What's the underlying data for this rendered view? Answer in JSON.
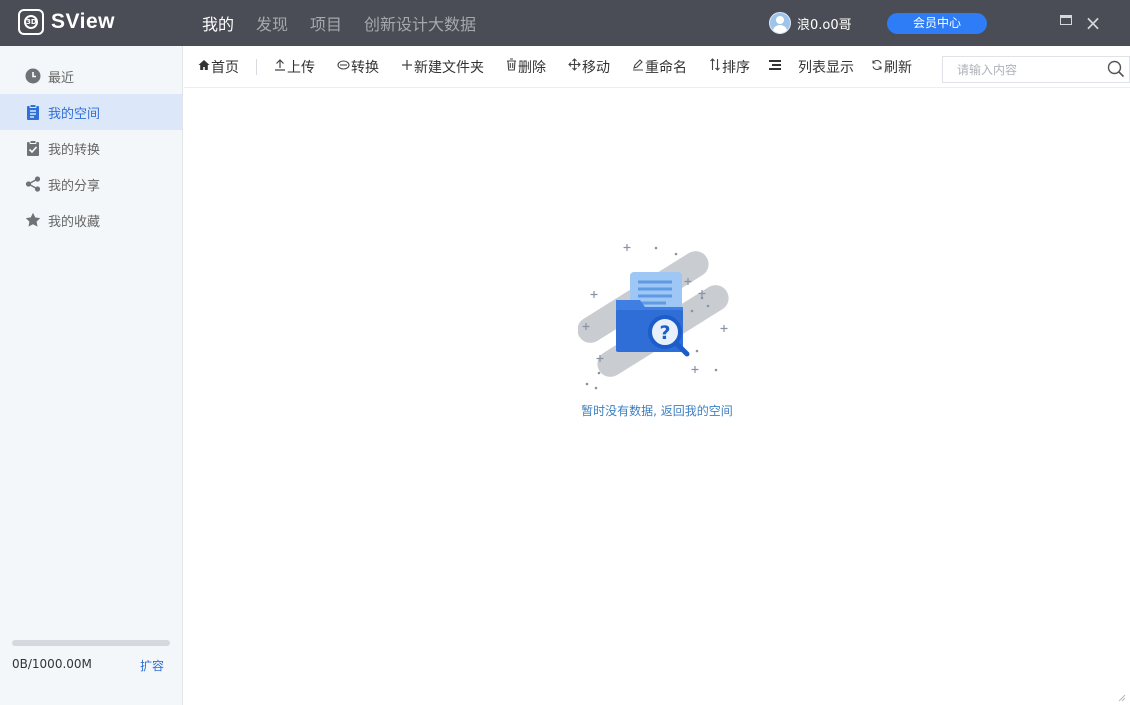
{
  "app": {
    "name": "SView",
    "logo_mark": "3D"
  },
  "nav": [
    {
      "label": "我的",
      "active": true
    },
    {
      "label": "发现",
      "active": false
    },
    {
      "label": "项目",
      "active": false
    },
    {
      "label": "创新设计大数据",
      "active": false
    }
  ],
  "user": {
    "name": "浪0.o0哥",
    "avatar_icon": "user-avatar-icon"
  },
  "vip_button": "会员中心",
  "sidebar": {
    "items": [
      {
        "label": "最近",
        "icon": "clock-icon",
        "active": false
      },
      {
        "label": "我的空间",
        "icon": "clipboard-icon",
        "active": true
      },
      {
        "label": "我的转换",
        "icon": "clipboard-check-icon",
        "active": false
      },
      {
        "label": "我的分享",
        "icon": "share-icon",
        "active": false
      },
      {
        "label": "我的收藏",
        "icon": "star-icon",
        "active": false
      }
    ],
    "storage": {
      "used_text": "0B/1000.00M",
      "used_fraction": 0,
      "expand_label": "扩容"
    }
  },
  "toolbar": {
    "home": "首页",
    "upload": "上传",
    "convert": "转换",
    "new_folder": "新建文件夹",
    "delete": "删除",
    "move": "移动",
    "rename": "重命名",
    "sort": "排序",
    "list_view": "列表显示",
    "refresh": "刷新",
    "search_placeholder": "请输入内容"
  },
  "empty_state": {
    "message": "暂时没有数据, 返回我的空间"
  },
  "colors": {
    "titlebar": "#4a4d55",
    "accent": "#2e7cf6",
    "sidebar_bg": "#f4f7fa",
    "active_bg": "#dce8f9"
  }
}
